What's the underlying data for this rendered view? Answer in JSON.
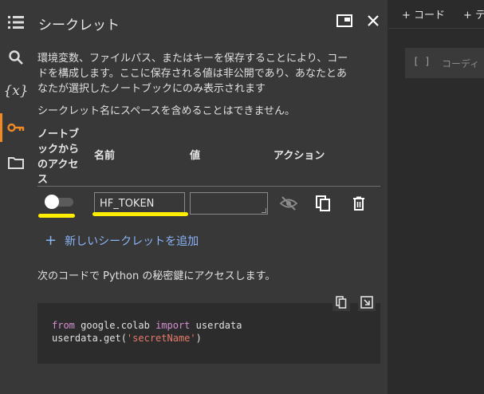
{
  "rail": {
    "icons": [
      "table-of-contents-icon",
      "search-icon",
      "variables-icon",
      "key-icon",
      "folder-icon"
    ],
    "variables_glyph": "{x}",
    "accent": "#f08a24"
  },
  "panel": {
    "title": "シークレット",
    "description": "環境変数、ファイルパス、またはキーを保存することにより、コードを構成します。ここに保存される値は非公開であり、あなたとあなたが選択したノートブックにのみ表示されます",
    "no_spaces_note": "シークレット名にスペースを含めることはできません。",
    "table": {
      "headers": {
        "access": "ノートブックからのアクセス",
        "name": "名前",
        "value": "値",
        "action": "アクション"
      },
      "rows": [
        {
          "access_enabled": false,
          "name": "HF_TOKEN",
          "value": ""
        }
      ]
    },
    "add_secret_label": "新しいシークレットを追加",
    "code_description": "次のコードで Python の秘密鍵にアクセスします。",
    "code": {
      "line1_kw_from": "from",
      "line1_mod": " google.colab ",
      "line1_kw_import": "import",
      "line1_name": " userdata",
      "line2_call": "userdata.get(",
      "line2_str": "'secretName'",
      "line2_end": ")"
    },
    "annotation_color": "#ffee00"
  },
  "notebook": {
    "add_code_label": "+ コード",
    "add_text_label": "+ テ",
    "cell_bracket": "[ ]",
    "cell_placeholder": "コーディ"
  }
}
